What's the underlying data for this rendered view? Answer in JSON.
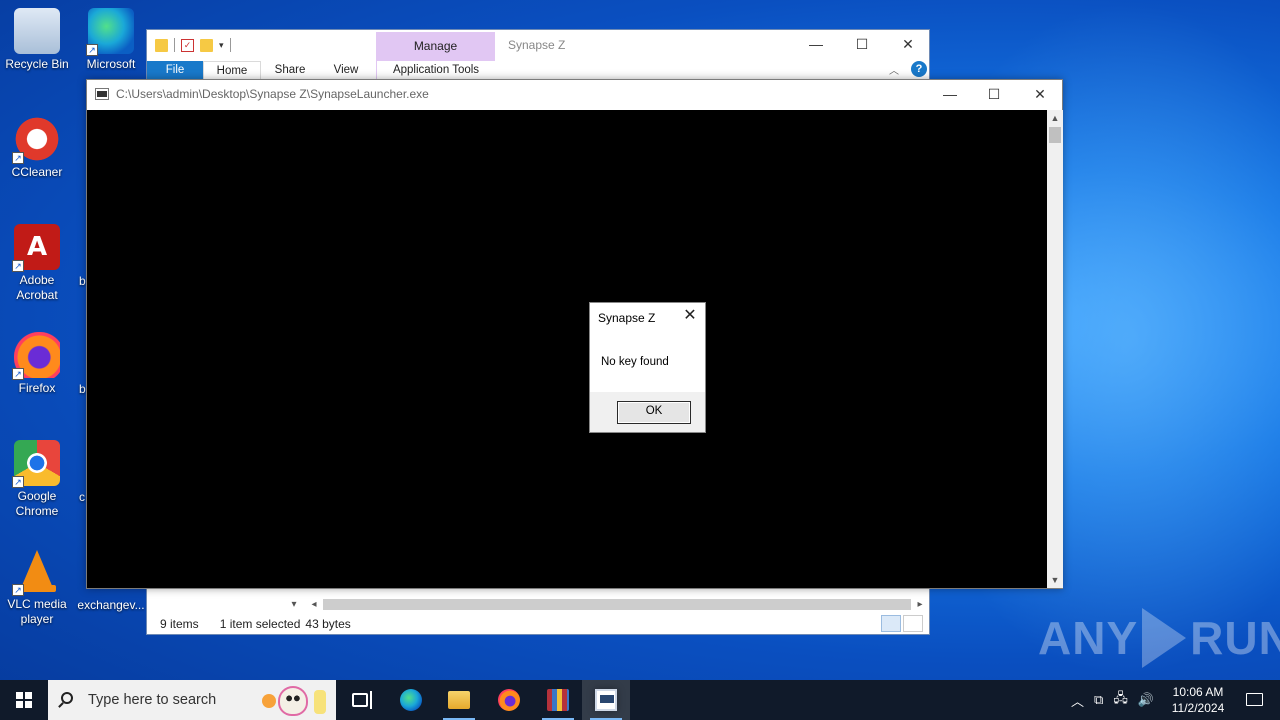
{
  "desktop": {
    "icons": [
      {
        "label": "Recycle Bin"
      },
      {
        "label": "Microsoft Edge"
      },
      {
        "label": "CCleaner"
      },
      {
        "label": "Adobe Acrobat"
      },
      {
        "label": "Firefox"
      },
      {
        "label": "Google Chrome"
      },
      {
        "label": "VLC media player"
      },
      {
        "label": "exchangev..."
      }
    ],
    "partial_labels": [
      "b",
      "b",
      "c"
    ]
  },
  "explorer": {
    "title": "Synapse Z",
    "manage_tab": "Manage",
    "tabs": {
      "file": "File",
      "home": "Home",
      "share": "Share",
      "view": "View",
      "app_tools": "Application Tools"
    },
    "status": {
      "items": "9 items",
      "selected": "1 item selected",
      "size": "43 bytes"
    }
  },
  "console": {
    "title": "C:\\Users\\admin\\Desktop\\Synapse Z\\SynapseLauncher.exe"
  },
  "dialog": {
    "title": "Synapse Z",
    "message": "No key found",
    "ok_label": "OK"
  },
  "watermark": {
    "left": "ANY",
    "right": "RUN"
  },
  "taskbar": {
    "search_placeholder": "Type here to search",
    "time": "10:06 AM",
    "date": "11/2/2024"
  },
  "colors": {
    "explorer_file_tab": "#1979ca",
    "manage_tab": "#e1c7f3",
    "taskbar": "#101a2a"
  }
}
